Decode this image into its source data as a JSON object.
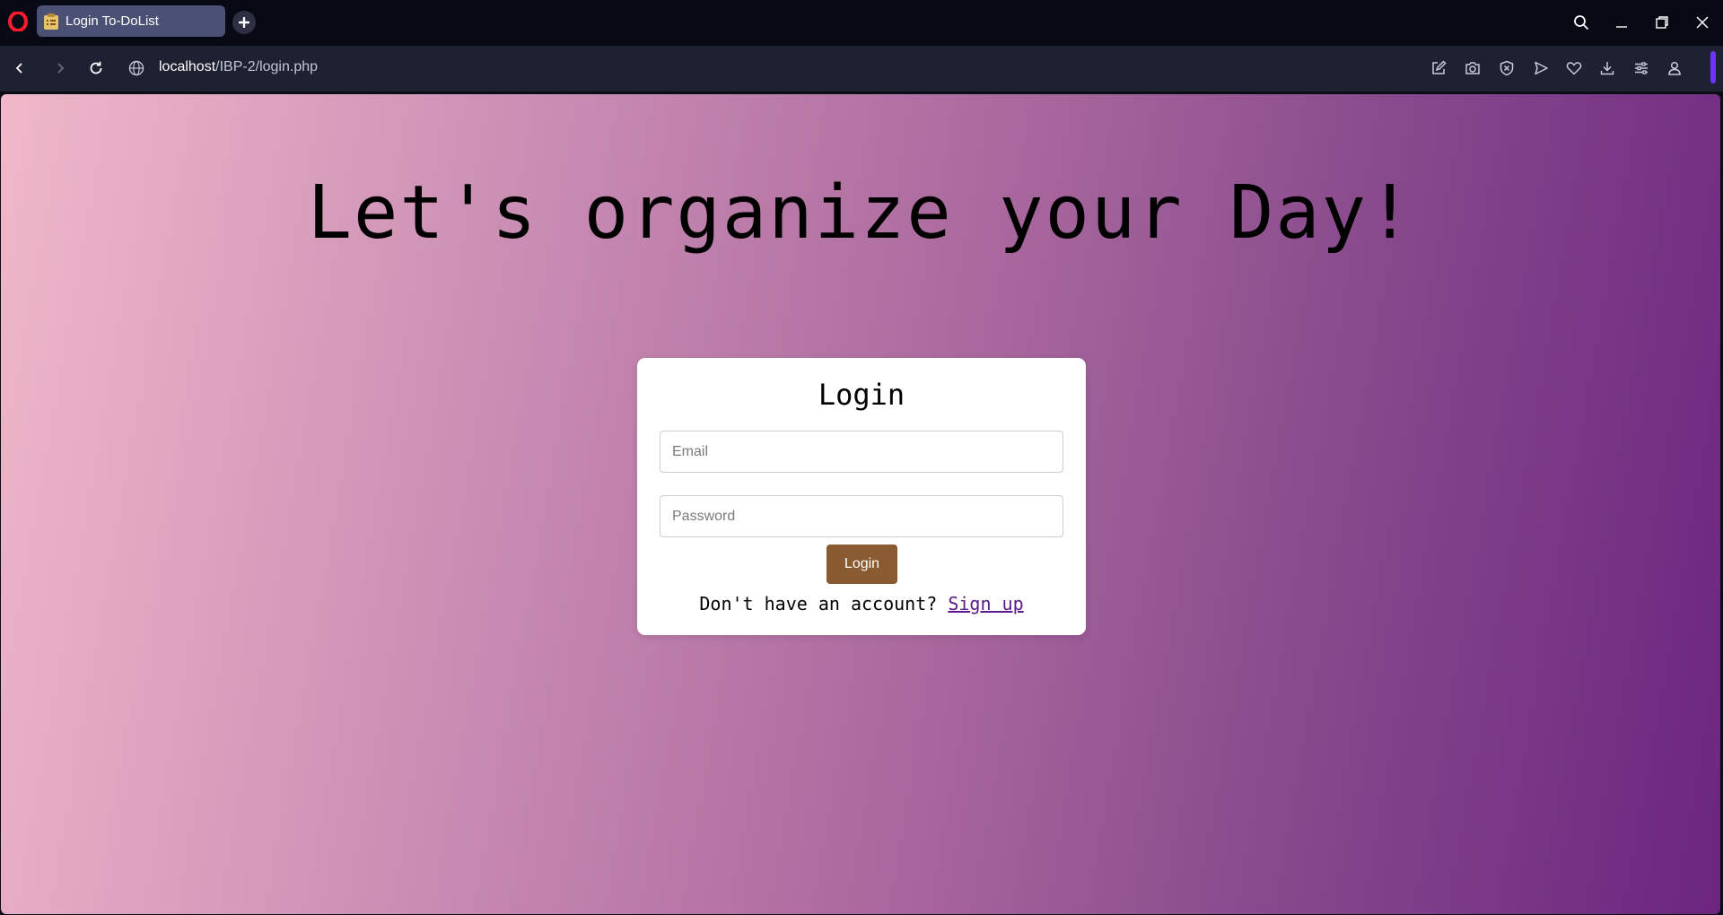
{
  "browser": {
    "tab": {
      "title": "Login To-DoList",
      "favicon": "clipboard-icon"
    },
    "url": {
      "host": "localhost",
      "path": "/IBP-2/login.php"
    },
    "toolbar_icons": [
      "edit-icon",
      "camera-icon",
      "shield-icon",
      "send-icon",
      "heart-icon",
      "download-icon",
      "settings-sliders-icon",
      "profile-icon"
    ],
    "colors": {
      "accent": "#6b33ff",
      "opera_red": "#ff1b2d"
    }
  },
  "page": {
    "headline": "Let's organize your Day!",
    "login_card": {
      "title": "Login",
      "email_placeholder": "Email",
      "password_placeholder": "Password",
      "submit_label": "Login",
      "signup_prompt": "Don't have an account?",
      "signup_link": "Sign up"
    },
    "colors": {
      "button": "#8a5a30",
      "gradient_start": "#f0b8c9",
      "gradient_end": "#6b257f"
    }
  }
}
